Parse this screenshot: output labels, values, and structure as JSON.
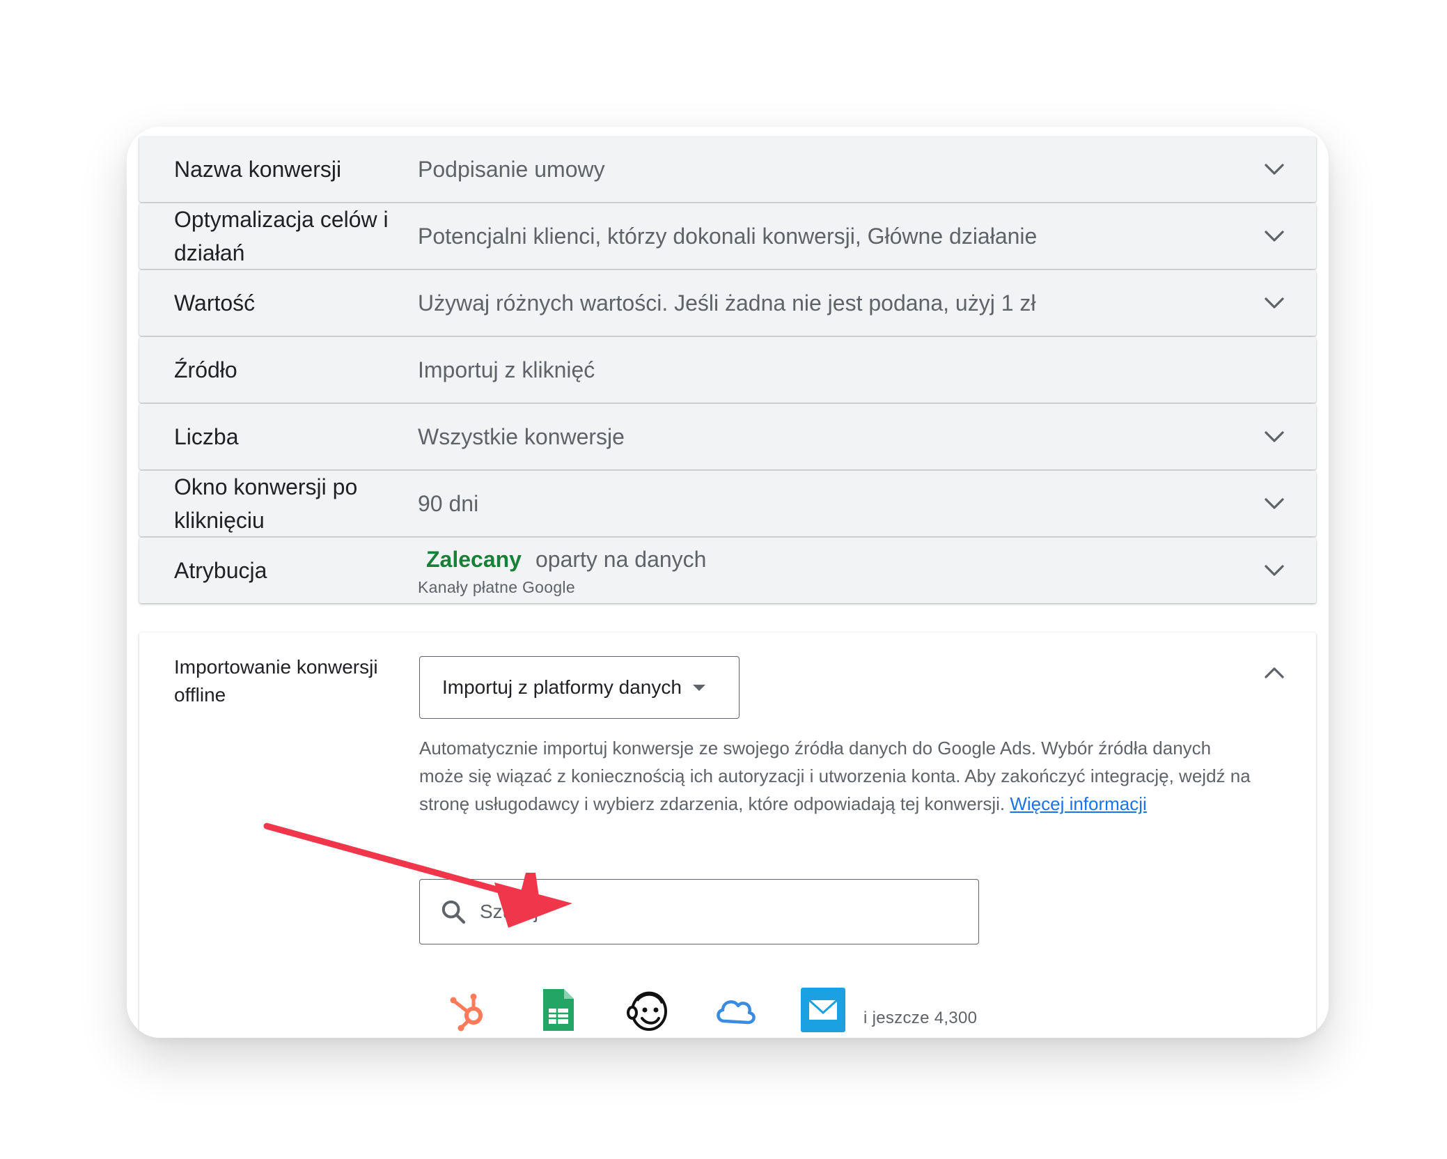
{
  "rows": [
    {
      "label": "Nazwa konwersji",
      "value": "Podpisanie umowy",
      "expandable": true
    },
    {
      "label": "Optymalizacja celów i działań",
      "value": "Potencjalni klienci, którzy dokonali konwersji, Główne działanie",
      "expandable": true
    },
    {
      "label": "Wartość",
      "value": "Używaj różnych wartości. Jeśli żadna nie jest podana, użyj 1 zł",
      "expandable": true
    },
    {
      "label": "Źródło",
      "value": "Importuj z kliknięć",
      "expandable": false
    },
    {
      "label": "Liczba",
      "value": "Wszystkie konwersje",
      "expandable": true
    },
    {
      "label": "Okno konwersji po kliknięciu",
      "value": "90 dni",
      "expandable": true
    }
  ],
  "attribution": {
    "label": "Atrybucja",
    "badge": "Zalecany",
    "value": "oparty na danych",
    "sub": "Kanały płatne Google"
  },
  "offline_import": {
    "label": "Importowanie konwersji offline",
    "dropdown_value": "Importuj z platformy danych",
    "description": "Automatycznie importuj konwersje ze swojego źródła danych do Google Ads. Wybór źródła danych może się wiązać z koniecznością ich autoryzacji i utworzenia konta. Aby zakończyć integrację, wejdź na stronę usługodawcy i wybierz zdarzenia, które odpowiadają tej konwersji.",
    "learn_more": "Więcej informacji",
    "search_placeholder": "Szukaj",
    "search_value": "",
    "integrations": [
      "hubspot-logo",
      "google-sheets-logo",
      "mailchimp-logo",
      "cloud-logo",
      "email-logo"
    ],
    "more_text": "i jeszcze 4,300"
  },
  "colors": {
    "row_bg": "#f1f3f4",
    "badge_green": "#188038",
    "link_blue": "#1a73e8",
    "annotation_arrow": "#f0364a"
  }
}
